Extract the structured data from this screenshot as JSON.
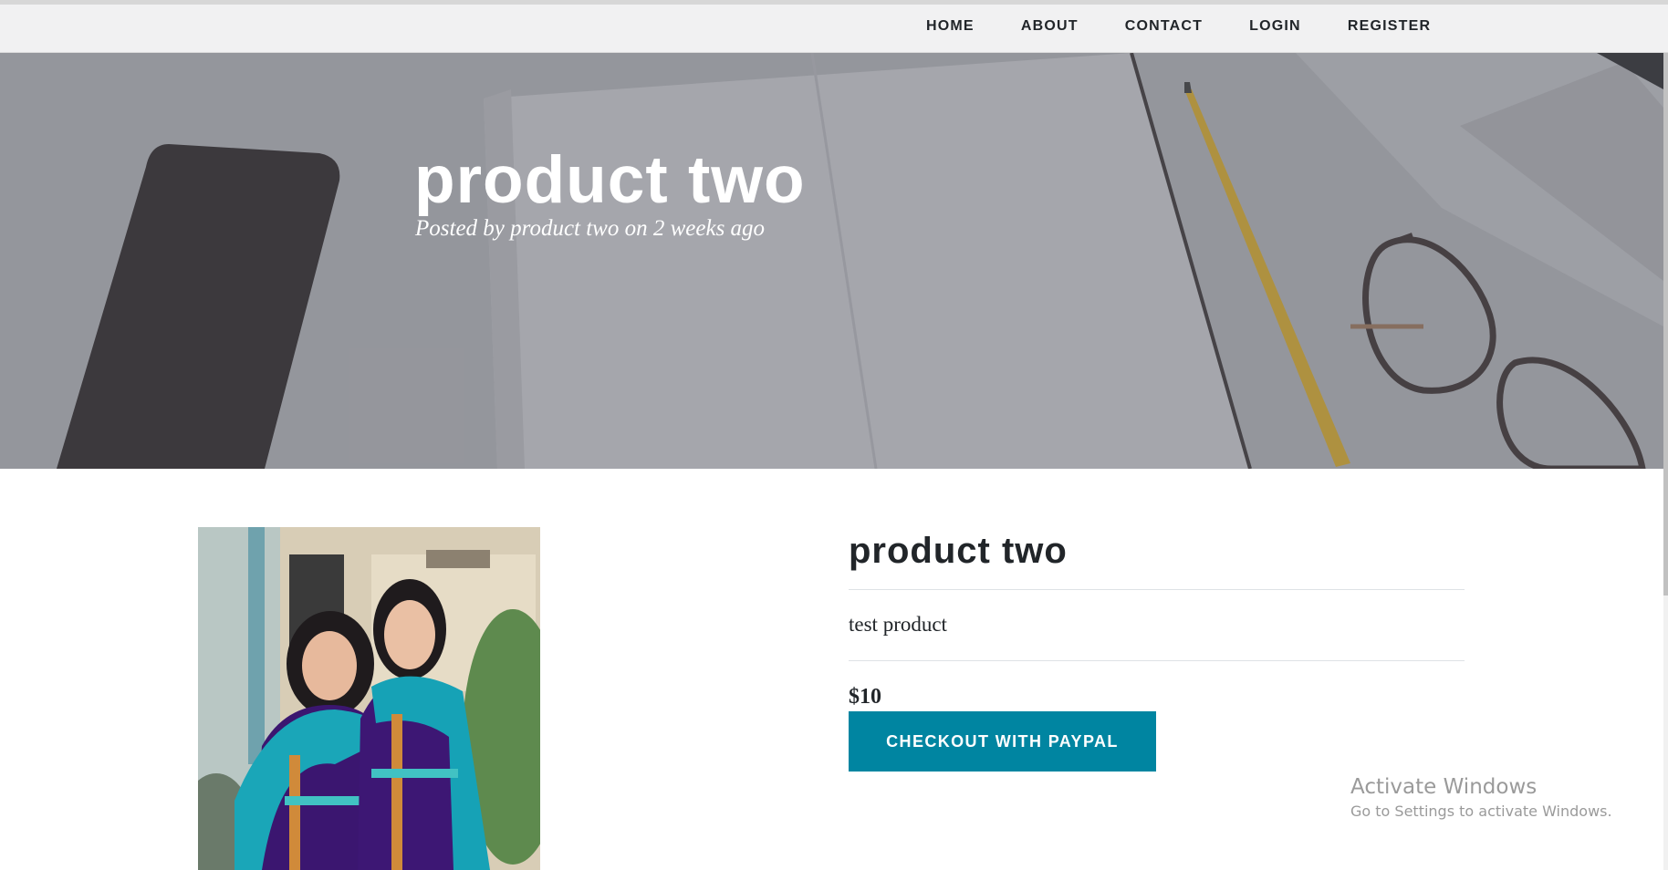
{
  "nav": {
    "items": [
      {
        "label": "HOME"
      },
      {
        "label": "ABOUT"
      },
      {
        "label": "CONTACT"
      },
      {
        "label": "LOGIN"
      },
      {
        "label": "REGISTER"
      }
    ]
  },
  "hero": {
    "title": "product two",
    "meta": "Posted by product two on 2 weeks ago"
  },
  "product": {
    "title": "product two",
    "description": "test product",
    "price": "$10",
    "checkout_label": "CHECKOUT WITH PAYPAL"
  },
  "watermark": {
    "line1": "Activate Windows",
    "line2": "Go to Settings to activate Windows."
  },
  "colors": {
    "accent": "#0085a1",
    "nav_bg": "#f1f1f2",
    "text": "#212529"
  }
}
